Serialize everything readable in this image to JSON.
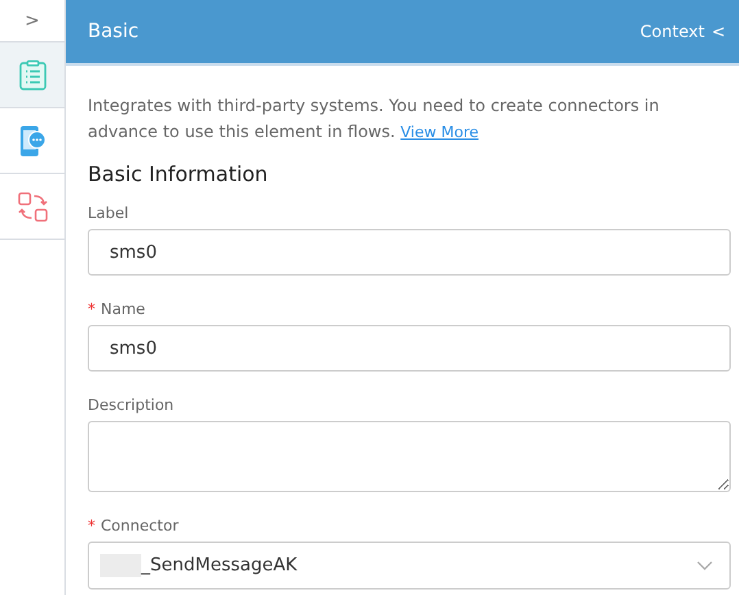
{
  "sidebar": {
    "toggle": ">",
    "items": [
      {
        "kind": "list",
        "selected": true
      },
      {
        "kind": "phone",
        "selected": false
      },
      {
        "kind": "swap",
        "selected": false
      }
    ]
  },
  "header": {
    "title": "Basic",
    "context": "Context",
    "context_icon": "<"
  },
  "intro": {
    "text": "Integrates with third-party systems. You need to create connectors in advance to use this element in flows.",
    "link": "View More"
  },
  "section_title": "Basic Information",
  "fields": [
    {
      "kind": "text",
      "label": "Label",
      "value": "sms0"
    },
    {
      "kind": "text",
      "label": "Name",
      "required_mark": "*",
      "value": "sms0"
    },
    {
      "kind": "textarea",
      "label": "Description"
    },
    {
      "kind": "select",
      "label": "Connector",
      "required_mark": "*",
      "value": "_SendMessageAK",
      "masked_prefix": true
    }
  ]
}
